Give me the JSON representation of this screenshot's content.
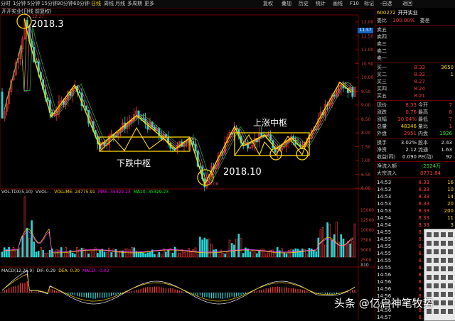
{
  "toolbar": {
    "timeframes": [
      "分时",
      "1分钟",
      "5分钟",
      "15分钟",
      "30分钟",
      "60分钟",
      "日线",
      "周线",
      "月线",
      "多周期",
      "更多"
    ],
    "selected_timeframe": "日线",
    "buttons": [
      "复权",
      "叠加",
      "历史",
      "统计",
      "画线",
      "F10",
      "标记",
      "-自选",
      "返回"
    ]
  },
  "chart_title": "开开实业(日线 前复权)",
  "price_axis": {
    "labels": [
      "12.00",
      "11.50",
      "11.00",
      "10.50",
      "10.00",
      "9.50",
      "9.00",
      "8.50",
      "8.00",
      "7.50",
      "7.00",
      "6.50",
      "6.00"
    ],
    "current": "11.57"
  },
  "peak_label": "12.27",
  "low_label": "6.08",
  "annotations": {
    "peak_date": "2018.3",
    "low_date": "2018.10",
    "down_pivot": "下跌中枢",
    "up_pivot": "上涨中枢"
  },
  "volume_panel": {
    "header": [
      "VOL-TDX(5,10)",
      "VVOL: -",
      "VOLUME: 24775.91",
      "MA5: 35329.23",
      "MA10: 35329.23"
    ],
    "ticks": [
      "15000",
      "12500",
      "10000",
      "7500",
      "5000",
      "2500"
    ],
    "unit": "X10"
  },
  "macd_panel": {
    "header": [
      "MACD(12,26,9)",
      "DIF: 0.29",
      "DEA: 0.30",
      "MACD: -0.02"
    ]
  },
  "quote": {
    "code": "600272",
    "name": "开开实业",
    "ratio_label": "委比",
    "ratio_value": "100.00%",
    "diff_label": "委差",
    "asks": [
      {
        "label": "卖五",
        "price": "",
        "vol": ""
      },
      {
        "label": "卖四",
        "price": "",
        "vol": ""
      },
      {
        "label": "卖三",
        "price": "",
        "vol": ""
      },
      {
        "label": "卖二",
        "price": "",
        "vol": ""
      },
      {
        "label": "卖一",
        "price": "",
        "vol": ""
      }
    ],
    "bids": [
      {
        "label": "买一",
        "price": "8.33",
        "vol": "3650"
      },
      {
        "label": "买二",
        "price": "8.32",
        "vol": "1"
      },
      {
        "label": "买三",
        "price": "8.27",
        "vol": ""
      },
      {
        "label": "买四",
        "price": "8.24",
        "vol": ""
      },
      {
        "label": "买五",
        "price": "8.21",
        "vol": ""
      }
    ],
    "stats": [
      {
        "a": "现价",
        "av": "8.33",
        "b": "今开",
        "bv": "7"
      },
      {
        "a": "涨跌",
        "av": "0.76",
        "b": "最高",
        "bv": "8"
      },
      {
        "a": "涨幅",
        "av": "10.04%",
        "b": "最低",
        "bv": "7"
      },
      {
        "a": "总量",
        "av": "48346",
        "b": "量比",
        "bv": "1"
      },
      {
        "a": "外盘",
        "av": "2951",
        "b": "内盘",
        "bv": "1926"
      }
    ],
    "fund": [
      {
        "a": "换手",
        "av": "3.02%",
        "b": "股本",
        "bv": "2.43"
      },
      {
        "a": "净资",
        "av": "2.12",
        "b": "流通",
        "bv": "1.63"
      },
      {
        "a": "收益(四)",
        "av": "0.090",
        "b": "PE(动)",
        "bv": "92"
      }
    ],
    "flows": [
      {
        "a": "净流入额",
        "av": "-2524万",
        "b": "",
        "bv": ""
      },
      {
        "a": "大宗流入",
        "av": "8771.84",
        "b": "",
        "bv": ""
      }
    ],
    "ticks": [
      {
        "t": "14:53",
        "p": "8.33",
        "v": "16"
      },
      {
        "t": "14:53",
        "p": "8.33",
        "v": "10"
      },
      {
        "t": "14:53",
        "p": "8.33",
        "v": "14"
      },
      {
        "t": "14:53",
        "p": "8.33",
        "v": "20"
      },
      {
        "t": "14:53",
        "p": "8.33",
        "v": "200"
      },
      {
        "t": "14:54",
        "p": "8.33",
        "v": "11"
      },
      {
        "t": "14:54",
        "p": "8.33",
        "v": "3"
      },
      {
        "t": "14:55",
        "p": "8.33",
        "v": "10"
      },
      {
        "t": "14:55",
        "p": "8.33",
        "v": "50"
      },
      {
        "t": "14:55",
        "p": "8.33",
        "v": ""
      },
      {
        "t": "14:55",
        "p": "8.33",
        "v": ""
      },
      {
        "t": "14:55",
        "p": "8.33",
        "v": ""
      },
      {
        "t": "14:55",
        "p": "8.33",
        "v": ""
      },
      {
        "t": "14:56",
        "p": "8.33",
        "v": ""
      },
      {
        "t": "14:56",
        "p": "8.33",
        "v": ""
      },
      {
        "t": "14:56",
        "p": "8.33",
        "v": ""
      },
      {
        "t": "14:56",
        "p": "8.33",
        "v": ""
      },
      {
        "t": "14:56",
        "p": "8.33",
        "v": ""
      },
      {
        "t": "14:56",
        "p": "8.33",
        "v": ""
      },
      {
        "t": "14:57",
        "p": "8.33",
        "v": ""
      }
    ]
  },
  "watermark": "头条 @亿启神笔牧势",
  "colors": {
    "up": "#ff3a3a",
    "down": "#2fe02f",
    "annotation": "#ffd400",
    "label": "#ffffff"
  }
}
